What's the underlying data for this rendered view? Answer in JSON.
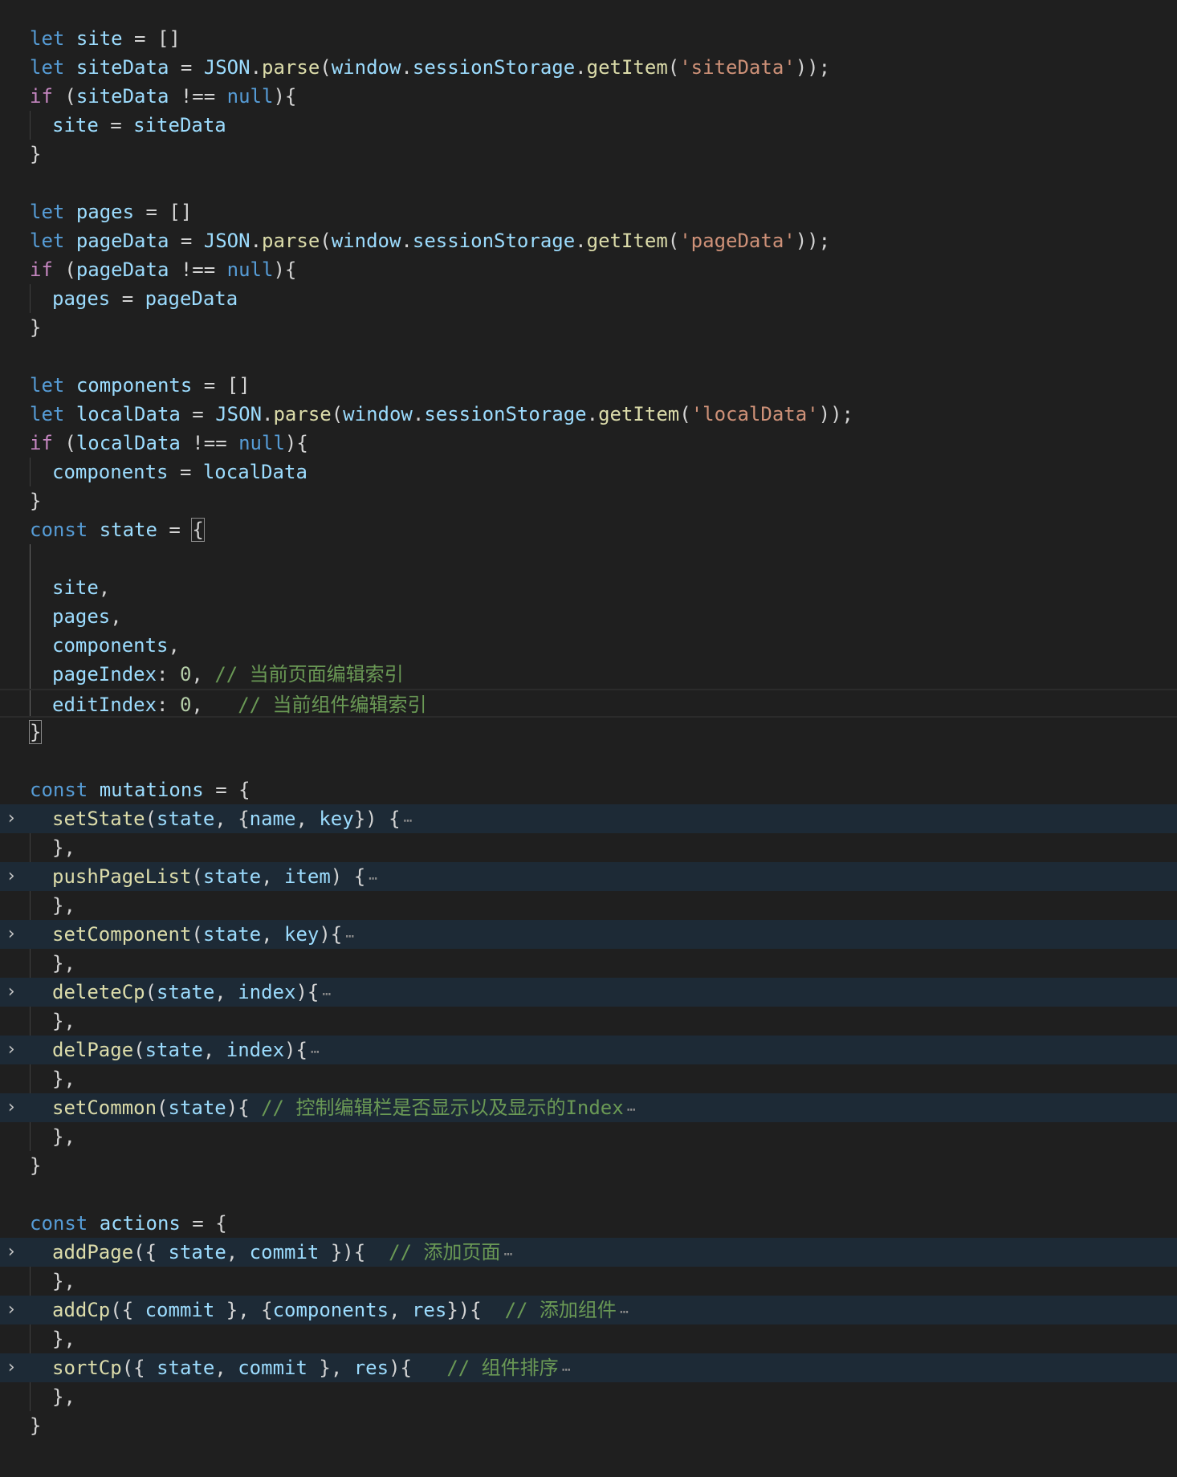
{
  "lines": [
    {
      "tokens": [
        [
          "kw",
          "let"
        ],
        [
          "pl",
          " "
        ],
        [
          "var",
          "site"
        ],
        [
          "pl",
          " = []"
        ]
      ]
    },
    {
      "tokens": [
        [
          "kw",
          "let"
        ],
        [
          "pl",
          " "
        ],
        [
          "var",
          "siteData"
        ],
        [
          "pl",
          " = "
        ],
        [
          "var",
          "JSON"
        ],
        [
          "pl",
          "."
        ],
        [
          "fn",
          "parse"
        ],
        [
          "pl",
          "("
        ],
        [
          "var",
          "window"
        ],
        [
          "pl",
          "."
        ],
        [
          "var",
          "sessionStorage"
        ],
        [
          "pl",
          "."
        ],
        [
          "fn",
          "getItem"
        ],
        [
          "pl",
          "("
        ],
        [
          "str",
          "'siteData'"
        ],
        [
          "pl",
          "));"
        ]
      ]
    },
    {
      "tokens": [
        [
          "ctl",
          "if"
        ],
        [
          "pl",
          " ("
        ],
        [
          "var",
          "siteData"
        ],
        [
          "pl",
          " !== "
        ],
        [
          "kw",
          "null"
        ],
        [
          "pl",
          "){"
        ]
      ]
    },
    {
      "indent": true,
      "tokens": [
        [
          "var",
          "site"
        ],
        [
          "pl",
          " = "
        ],
        [
          "var",
          "siteData"
        ]
      ]
    },
    {
      "tokens": [
        [
          "pl",
          "}"
        ]
      ]
    },
    {
      "tokens": []
    },
    {
      "tokens": [
        [
          "kw",
          "let"
        ],
        [
          "pl",
          " "
        ],
        [
          "var",
          "pages"
        ],
        [
          "pl",
          " = []"
        ]
      ]
    },
    {
      "tokens": [
        [
          "kw",
          "let"
        ],
        [
          "pl",
          " "
        ],
        [
          "var",
          "pageData"
        ],
        [
          "pl",
          " = "
        ],
        [
          "var",
          "JSON"
        ],
        [
          "pl",
          "."
        ],
        [
          "fn",
          "parse"
        ],
        [
          "pl",
          "("
        ],
        [
          "var",
          "window"
        ],
        [
          "pl",
          "."
        ],
        [
          "var",
          "sessionStorage"
        ],
        [
          "pl",
          "."
        ],
        [
          "fn",
          "getItem"
        ],
        [
          "pl",
          "("
        ],
        [
          "str",
          "'pageData'"
        ],
        [
          "pl",
          "));"
        ]
      ]
    },
    {
      "tokens": [
        [
          "ctl",
          "if"
        ],
        [
          "pl",
          " ("
        ],
        [
          "var",
          "pageData"
        ],
        [
          "pl",
          " !== "
        ],
        [
          "kw",
          "null"
        ],
        [
          "pl",
          "){"
        ]
      ]
    },
    {
      "indent": true,
      "tokens": [
        [
          "var",
          "pages"
        ],
        [
          "pl",
          " = "
        ],
        [
          "var",
          "pageData"
        ]
      ]
    },
    {
      "tokens": [
        [
          "pl",
          "}"
        ]
      ]
    },
    {
      "tokens": []
    },
    {
      "tokens": [
        [
          "kw",
          "let"
        ],
        [
          "pl",
          " "
        ],
        [
          "var",
          "components"
        ],
        [
          "pl",
          " = []"
        ]
      ]
    },
    {
      "tokens": [
        [
          "kw",
          "let"
        ],
        [
          "pl",
          " "
        ],
        [
          "var",
          "localData"
        ],
        [
          "pl",
          " = "
        ],
        [
          "var",
          "JSON"
        ],
        [
          "pl",
          "."
        ],
        [
          "fn",
          "parse"
        ],
        [
          "pl",
          "("
        ],
        [
          "var",
          "window"
        ],
        [
          "pl",
          "."
        ],
        [
          "var",
          "sessionStorage"
        ],
        [
          "pl",
          "."
        ],
        [
          "fn",
          "getItem"
        ],
        [
          "pl",
          "("
        ],
        [
          "str",
          "'localData'"
        ],
        [
          "pl",
          "));"
        ]
      ]
    },
    {
      "tokens": [
        [
          "ctl",
          "if"
        ],
        [
          "pl",
          " ("
        ],
        [
          "var",
          "localData"
        ],
        [
          "pl",
          " !== "
        ],
        [
          "kw",
          "null"
        ],
        [
          "pl",
          "){"
        ]
      ]
    },
    {
      "indent": true,
      "tokens": [
        [
          "var",
          "components"
        ],
        [
          "pl",
          " = "
        ],
        [
          "var",
          "localData"
        ]
      ]
    },
    {
      "tokens": [
        [
          "pl",
          "}"
        ]
      ]
    },
    {
      "tokens": [
        [
          "kw",
          "const"
        ],
        [
          "pl",
          " "
        ],
        [
          "var",
          "state"
        ],
        [
          "pl",
          " = "
        ],
        [
          "box",
          "{"
        ]
      ]
    },
    {
      "tokens": []
    },
    {
      "indent": true,
      "tokens": [
        [
          "var",
          "site"
        ],
        [
          "pl",
          ","
        ]
      ]
    },
    {
      "indent": true,
      "tokens": [
        [
          "var",
          "pages"
        ],
        [
          "pl",
          ","
        ]
      ]
    },
    {
      "indent": true,
      "tokens": [
        [
          "var",
          "components"
        ],
        [
          "pl",
          ","
        ]
      ]
    },
    {
      "indent": true,
      "tokens": [
        [
          "var",
          "pageIndex"
        ],
        [
          "pl",
          ": "
        ],
        [
          "num",
          "0"
        ],
        [
          "pl",
          ", "
        ],
        [
          "cm",
          "// 当前页面编辑索引"
        ]
      ]
    },
    {
      "indent": true,
      "current": true,
      "tokens": [
        [
          "var",
          "editIndex"
        ],
        [
          "pl",
          ": "
        ],
        [
          "num",
          "0"
        ],
        [
          "pl",
          ",   "
        ],
        [
          "cm",
          "// 当前组件编辑索引"
        ]
      ]
    },
    {
      "tokens": [
        [
          "box",
          "}"
        ]
      ]
    },
    {
      "tokens": []
    },
    {
      "tokens": [
        [
          "kw",
          "const"
        ],
        [
          "pl",
          " "
        ],
        [
          "var",
          "mutations"
        ],
        [
          "pl",
          " = {"
        ]
      ]
    },
    {
      "indent": true,
      "folded": true,
      "tokens": [
        [
          "fn",
          "setState"
        ],
        [
          "pl",
          "("
        ],
        [
          "var",
          "state"
        ],
        [
          "pl",
          ", {"
        ],
        [
          "var",
          "name"
        ],
        [
          "pl",
          ", "
        ],
        [
          "var",
          "key"
        ],
        [
          "pl",
          "}) {"
        ]
      ]
    },
    {
      "indent": true,
      "tokens": [
        [
          "pl",
          "},"
        ]
      ]
    },
    {
      "indent": true,
      "folded": true,
      "tokens": [
        [
          "fn",
          "pushPageList"
        ],
        [
          "pl",
          "("
        ],
        [
          "var",
          "state"
        ],
        [
          "pl",
          ", "
        ],
        [
          "var",
          "item"
        ],
        [
          "pl",
          ") {"
        ]
      ]
    },
    {
      "indent": true,
      "tokens": [
        [
          "pl",
          "},"
        ]
      ]
    },
    {
      "indent": true,
      "folded": true,
      "tokens": [
        [
          "fn",
          "setComponent"
        ],
        [
          "pl",
          "("
        ],
        [
          "var",
          "state"
        ],
        [
          "pl",
          ", "
        ],
        [
          "var",
          "key"
        ],
        [
          "pl",
          "){"
        ]
      ]
    },
    {
      "indent": true,
      "tokens": [
        [
          "pl",
          "},"
        ]
      ]
    },
    {
      "indent": true,
      "folded": true,
      "tokens": [
        [
          "fn",
          "deleteCp"
        ],
        [
          "pl",
          "("
        ],
        [
          "var",
          "state"
        ],
        [
          "pl",
          ", "
        ],
        [
          "var",
          "index"
        ],
        [
          "pl",
          "){"
        ]
      ]
    },
    {
      "indent": true,
      "tokens": [
        [
          "pl",
          "},"
        ]
      ]
    },
    {
      "indent": true,
      "folded": true,
      "tokens": [
        [
          "fn",
          "delPage"
        ],
        [
          "pl",
          "("
        ],
        [
          "var",
          "state"
        ],
        [
          "pl",
          ", "
        ],
        [
          "var",
          "index"
        ],
        [
          "pl",
          "){"
        ]
      ]
    },
    {
      "indent": true,
      "tokens": [
        [
          "pl",
          "},"
        ]
      ]
    },
    {
      "indent": true,
      "folded": true,
      "tokens": [
        [
          "fn",
          "setCommon"
        ],
        [
          "pl",
          "("
        ],
        [
          "var",
          "state"
        ],
        [
          "pl",
          "){ "
        ],
        [
          "cm",
          "// 控制编辑栏是否显示以及显示的Index"
        ]
      ]
    },
    {
      "indent": true,
      "tokens": [
        [
          "pl",
          "},"
        ]
      ]
    },
    {
      "tokens": [
        [
          "pl",
          "}"
        ]
      ]
    },
    {
      "tokens": []
    },
    {
      "tokens": [
        [
          "kw",
          "const"
        ],
        [
          "pl",
          " "
        ],
        [
          "var",
          "actions"
        ],
        [
          "pl",
          " = {"
        ]
      ]
    },
    {
      "indent": true,
      "folded": true,
      "tokens": [
        [
          "fn",
          "addPage"
        ],
        [
          "pl",
          "({ "
        ],
        [
          "var",
          "state"
        ],
        [
          "pl",
          ", "
        ],
        [
          "var",
          "commit"
        ],
        [
          "pl",
          " }){  "
        ],
        [
          "cm",
          "// 添加页面"
        ]
      ]
    },
    {
      "indent": true,
      "tokens": [
        [
          "pl",
          "},"
        ]
      ]
    },
    {
      "indent": true,
      "folded": true,
      "tokens": [
        [
          "fn",
          "addCp"
        ],
        [
          "pl",
          "({ "
        ],
        [
          "var",
          "commit"
        ],
        [
          "pl",
          " }, {"
        ],
        [
          "var",
          "components"
        ],
        [
          "pl",
          ", "
        ],
        [
          "var",
          "res"
        ],
        [
          "pl",
          "}){  "
        ],
        [
          "cm",
          "// 添加组件"
        ]
      ]
    },
    {
      "indent": true,
      "tokens": [
        [
          "pl",
          "},"
        ]
      ]
    },
    {
      "indent": true,
      "folded": true,
      "tokens": [
        [
          "fn",
          "sortCp"
        ],
        [
          "pl",
          "({ "
        ],
        [
          "var",
          "state"
        ],
        [
          "pl",
          ", "
        ],
        [
          "var",
          "commit"
        ],
        [
          "pl",
          " }, "
        ],
        [
          "var",
          "res"
        ],
        [
          "pl",
          "){   "
        ],
        [
          "cm",
          "// 组件排序"
        ]
      ]
    },
    {
      "indent": true,
      "tokens": [
        [
          "pl",
          "},"
        ]
      ]
    },
    {
      "tokens": [
        [
          "pl",
          "}"
        ]
      ]
    }
  ],
  "fold_glyph": "›",
  "ellipsis_glyph": "⋯"
}
